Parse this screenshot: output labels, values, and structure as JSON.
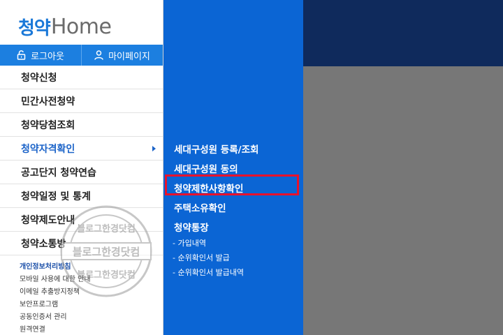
{
  "logo": {
    "mark": "청약",
    "home": "Home"
  },
  "userbar": {
    "logout": "로그아웃",
    "mypage": "마이페이지"
  },
  "menu": {
    "items": [
      {
        "label": "청약신청"
      },
      {
        "label": "민간사전청약"
      },
      {
        "label": "청약당첨조회"
      },
      {
        "label": "청약자격확인"
      },
      {
        "label": "공고단지 청약연습"
      },
      {
        "label": "청약일정 및 통계"
      },
      {
        "label": "청약제도안내"
      },
      {
        "label": "청약소통방"
      }
    ]
  },
  "links": {
    "items": [
      {
        "label": "개인정보처리방침"
      },
      {
        "label": "모바일 사용에 대한 안내"
      },
      {
        "label": "이메일 추출방지정책"
      },
      {
        "label": "보안프로그램"
      },
      {
        "label": "공동인증서 관리"
      },
      {
        "label": "원격연결"
      }
    ]
  },
  "submenu": {
    "items": [
      {
        "label": "세대구성원 등록/조회"
      },
      {
        "label": "세대구성원 동의"
      },
      {
        "label": "청약제한사항확인"
      },
      {
        "label": "주택소유확인"
      },
      {
        "label": "청약통장"
      }
    ],
    "subitems": [
      {
        "label": "- 가입내역"
      },
      {
        "label": "- 순위확인서 발급"
      },
      {
        "label": "- 순위확인서 발급내역"
      }
    ]
  },
  "watermark": {
    "top": "블로그한경닷컴",
    "center": "블로그한경닷컴",
    "bottom": "블로그한경닷컴"
  },
  "colors": {
    "accent": "#1c7fe0",
    "submenu_bg": "#0b65d4",
    "highlight": "#e8122c",
    "top_band": "#0f2a5c",
    "overlay": "#777777"
  }
}
